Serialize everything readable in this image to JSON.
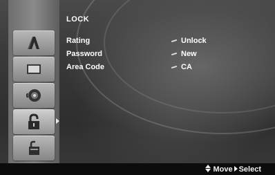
{
  "menu": {
    "title": "LOCK",
    "items": [
      {
        "label": "Rating",
        "value": "Unlock"
      },
      {
        "label": "Password",
        "value": "New"
      },
      {
        "label": "Area Code",
        "value": "CA"
      }
    ]
  },
  "sidebar": {
    "items": [
      {
        "icon": "language-icon",
        "active": false
      },
      {
        "icon": "display-icon",
        "active": false
      },
      {
        "icon": "audio-icon",
        "active": false
      },
      {
        "icon": "lock-icon",
        "active": true
      },
      {
        "icon": "others-icon",
        "active": false
      }
    ]
  },
  "footer": {
    "move_label": "Move",
    "select_label": "Select"
  }
}
